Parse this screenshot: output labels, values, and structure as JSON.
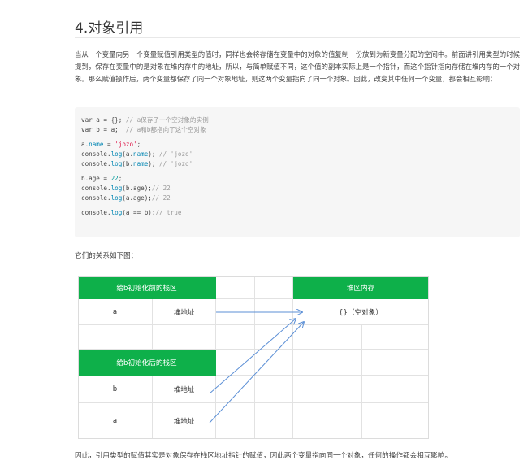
{
  "heading": "4.对象引用",
  "intro": "当从一个变量向另一个变量赋值引用类型的值时，同样也会将存储在变量中的对象的值复制一份放到为新变量分配的空间中。前面讲引用类型的时候提到，保存在变量中的是对象在堆内存中的地址，所以，与简单赋值不同，这个值的副本实际上是一个指针，而这个指针指向存储在堆内存的一个对象。那么赋值操作后，两个变量都保存了同一个对象地址，则这两个变量指向了同一个对象。因此，改变其中任何一个变量，都会相互影响：",
  "code": {
    "l1_code": "var a = {}; ",
    "l1_comment": "// a保存了一个空对象的实例",
    "l2_code": "var b = a;  ",
    "l2_comment": "// a和b都指向了这个空对象",
    "l3_pre": "a.",
    "l3_prop": "name",
    "l3_mid": " = ",
    "l3_str": "'jozo'",
    "l3_end": ";",
    "l4_pre": "console.",
    "l4_fn": "log",
    "l4_args": "(a.",
    "l4_prop": "name",
    "l4_close": "); ",
    "l4_comment": "// 'jozo'",
    "l5_pre": "console.",
    "l5_fn": "log",
    "l5_args": "(b.",
    "l5_prop": "name",
    "l5_close": "); ",
    "l5_comment": "// 'jozo'",
    "l6_pre": "b.age = ",
    "l6_num": "22",
    "l6_end": ";",
    "l7_pre": "console.",
    "l7_fn": "log",
    "l7_args": "(b.age);",
    "l7_comment": "// 22",
    "l8_pre": "console.",
    "l8_fn": "log",
    "l8_args": "(a.age);",
    "l8_comment": "// 22",
    "l9_pre": "console.",
    "l9_fn": "log",
    "l9_args": "(a == b);",
    "l9_comment": "// true"
  },
  "relation_text": "它们的关系如下图：",
  "diagram": {
    "stack_before_header": "给b初始化前的栈区",
    "heap_header": "堆区内存",
    "row_a_name": "a",
    "row_a_value": "堆地址",
    "heap_object": "{}（空对象）",
    "stack_after_header": "给b初始化后的栈区",
    "row_b_name": "b",
    "row_b_value": "堆地址",
    "row_a2_name": "a",
    "row_a2_value": "堆地址",
    "header_color": "#0eb04a",
    "arrow_color": "#5b8fd6"
  },
  "conclusion": "因此，引用类型的赋值其实是对象保存在栈区地址指针的赋值，因此两个变量指向同一个对象，任何的操作都会相互影响。"
}
